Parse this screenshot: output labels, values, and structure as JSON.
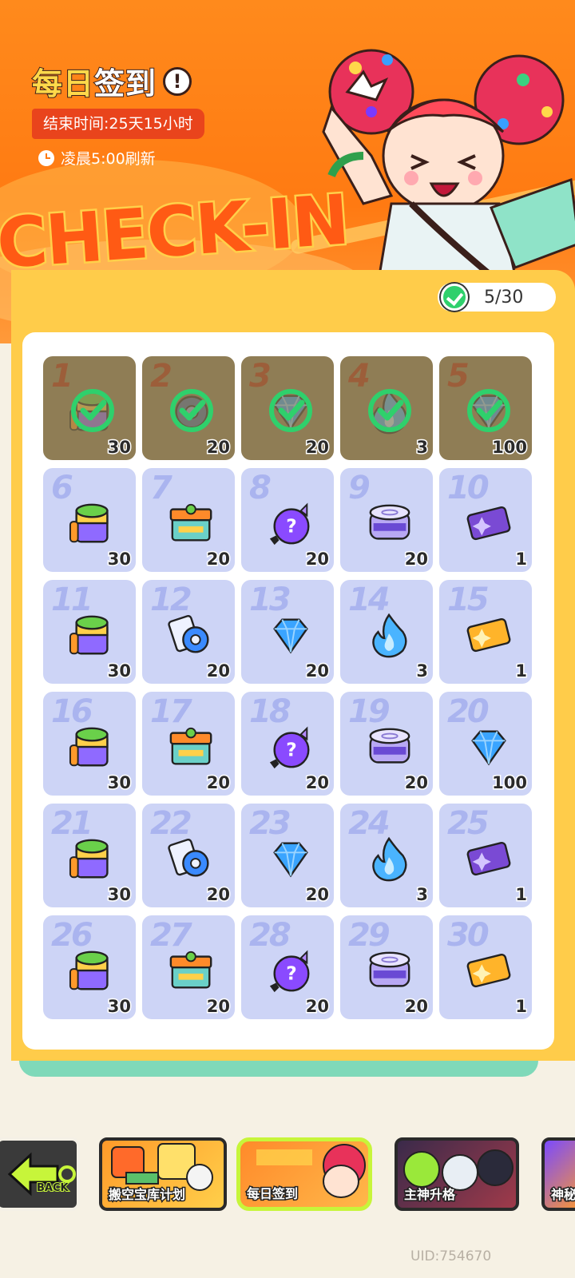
{
  "header": {
    "title_part1": "每日",
    "title_part2": "签到",
    "info_icon": "!",
    "end_time": "结束时间:25天15小时",
    "refresh": "凌晨5:00刷新",
    "banner_word": "CHECK-IN"
  },
  "progress": {
    "text": "5/30"
  },
  "days": [
    {
      "day": "1",
      "qty": "30",
      "item": "paint-bucket",
      "claimed": true
    },
    {
      "day": "2",
      "qty": "20",
      "item": "gear-cog",
      "claimed": true
    },
    {
      "day": "3",
      "qty": "20",
      "item": "diamond",
      "claimed": true
    },
    {
      "day": "4",
      "qty": "3",
      "item": "blue-flame",
      "claimed": true
    },
    {
      "day": "5",
      "qty": "100",
      "item": "diamond",
      "claimed": true
    },
    {
      "day": "6",
      "qty": "30",
      "item": "paint-bucket",
      "claimed": false
    },
    {
      "day": "7",
      "qty": "20",
      "item": "supply-box",
      "claimed": false
    },
    {
      "day": "8",
      "qty": "20",
      "item": "mystery-egg",
      "claimed": false
    },
    {
      "day": "9",
      "qty": "20",
      "item": "cool-can",
      "claimed": false
    },
    {
      "day": "10",
      "qty": "1",
      "item": "purple-ticket",
      "claimed": false
    },
    {
      "day": "11",
      "qty": "30",
      "item": "paint-bucket",
      "claimed": false
    },
    {
      "day": "12",
      "qty": "20",
      "item": "tape-roll",
      "claimed": false
    },
    {
      "day": "13",
      "qty": "20",
      "item": "diamond",
      "claimed": false
    },
    {
      "day": "14",
      "qty": "3",
      "item": "blue-flame",
      "claimed": false
    },
    {
      "day": "15",
      "qty": "1",
      "item": "gold-ticket",
      "claimed": false
    },
    {
      "day": "16",
      "qty": "30",
      "item": "paint-bucket",
      "claimed": false
    },
    {
      "day": "17",
      "qty": "20",
      "item": "supply-box",
      "claimed": false
    },
    {
      "day": "18",
      "qty": "20",
      "item": "mystery-egg",
      "claimed": false
    },
    {
      "day": "19",
      "qty": "20",
      "item": "cool-can",
      "claimed": false
    },
    {
      "day": "20",
      "qty": "100",
      "item": "diamond",
      "claimed": false
    },
    {
      "day": "21",
      "qty": "30",
      "item": "paint-bucket",
      "claimed": false
    },
    {
      "day": "22",
      "qty": "20",
      "item": "tape-roll",
      "claimed": false
    },
    {
      "day": "23",
      "qty": "20",
      "item": "diamond",
      "claimed": false
    },
    {
      "day": "24",
      "qty": "3",
      "item": "blue-flame",
      "claimed": false
    },
    {
      "day": "25",
      "qty": "1",
      "item": "purple-ticket",
      "claimed": false
    },
    {
      "day": "26",
      "qty": "30",
      "item": "paint-bucket",
      "claimed": false
    },
    {
      "day": "27",
      "qty": "20",
      "item": "supply-box",
      "claimed": false
    },
    {
      "day": "28",
      "qty": "20",
      "item": "mystery-egg",
      "claimed": false
    },
    {
      "day": "29",
      "qty": "20",
      "item": "cool-can",
      "claimed": false
    },
    {
      "day": "30",
      "qty": "1",
      "item": "gold-ticket",
      "claimed": false
    }
  ],
  "nav": {
    "back_label": "BACK",
    "vault_label": "搬空宝库计划",
    "checkin_label": "每日签到",
    "promote_label": "主神升格",
    "partial_label": "神秘"
  },
  "uid": "UID:754670",
  "colors": {
    "banner": "#ff7a12",
    "board": "#ffcc4a",
    "cell_unclaimed": "#cdd4f6",
    "cell_claimed": "#8f7d55",
    "check_green": "#2fd06c",
    "selected_frame": "#c7f53a"
  }
}
